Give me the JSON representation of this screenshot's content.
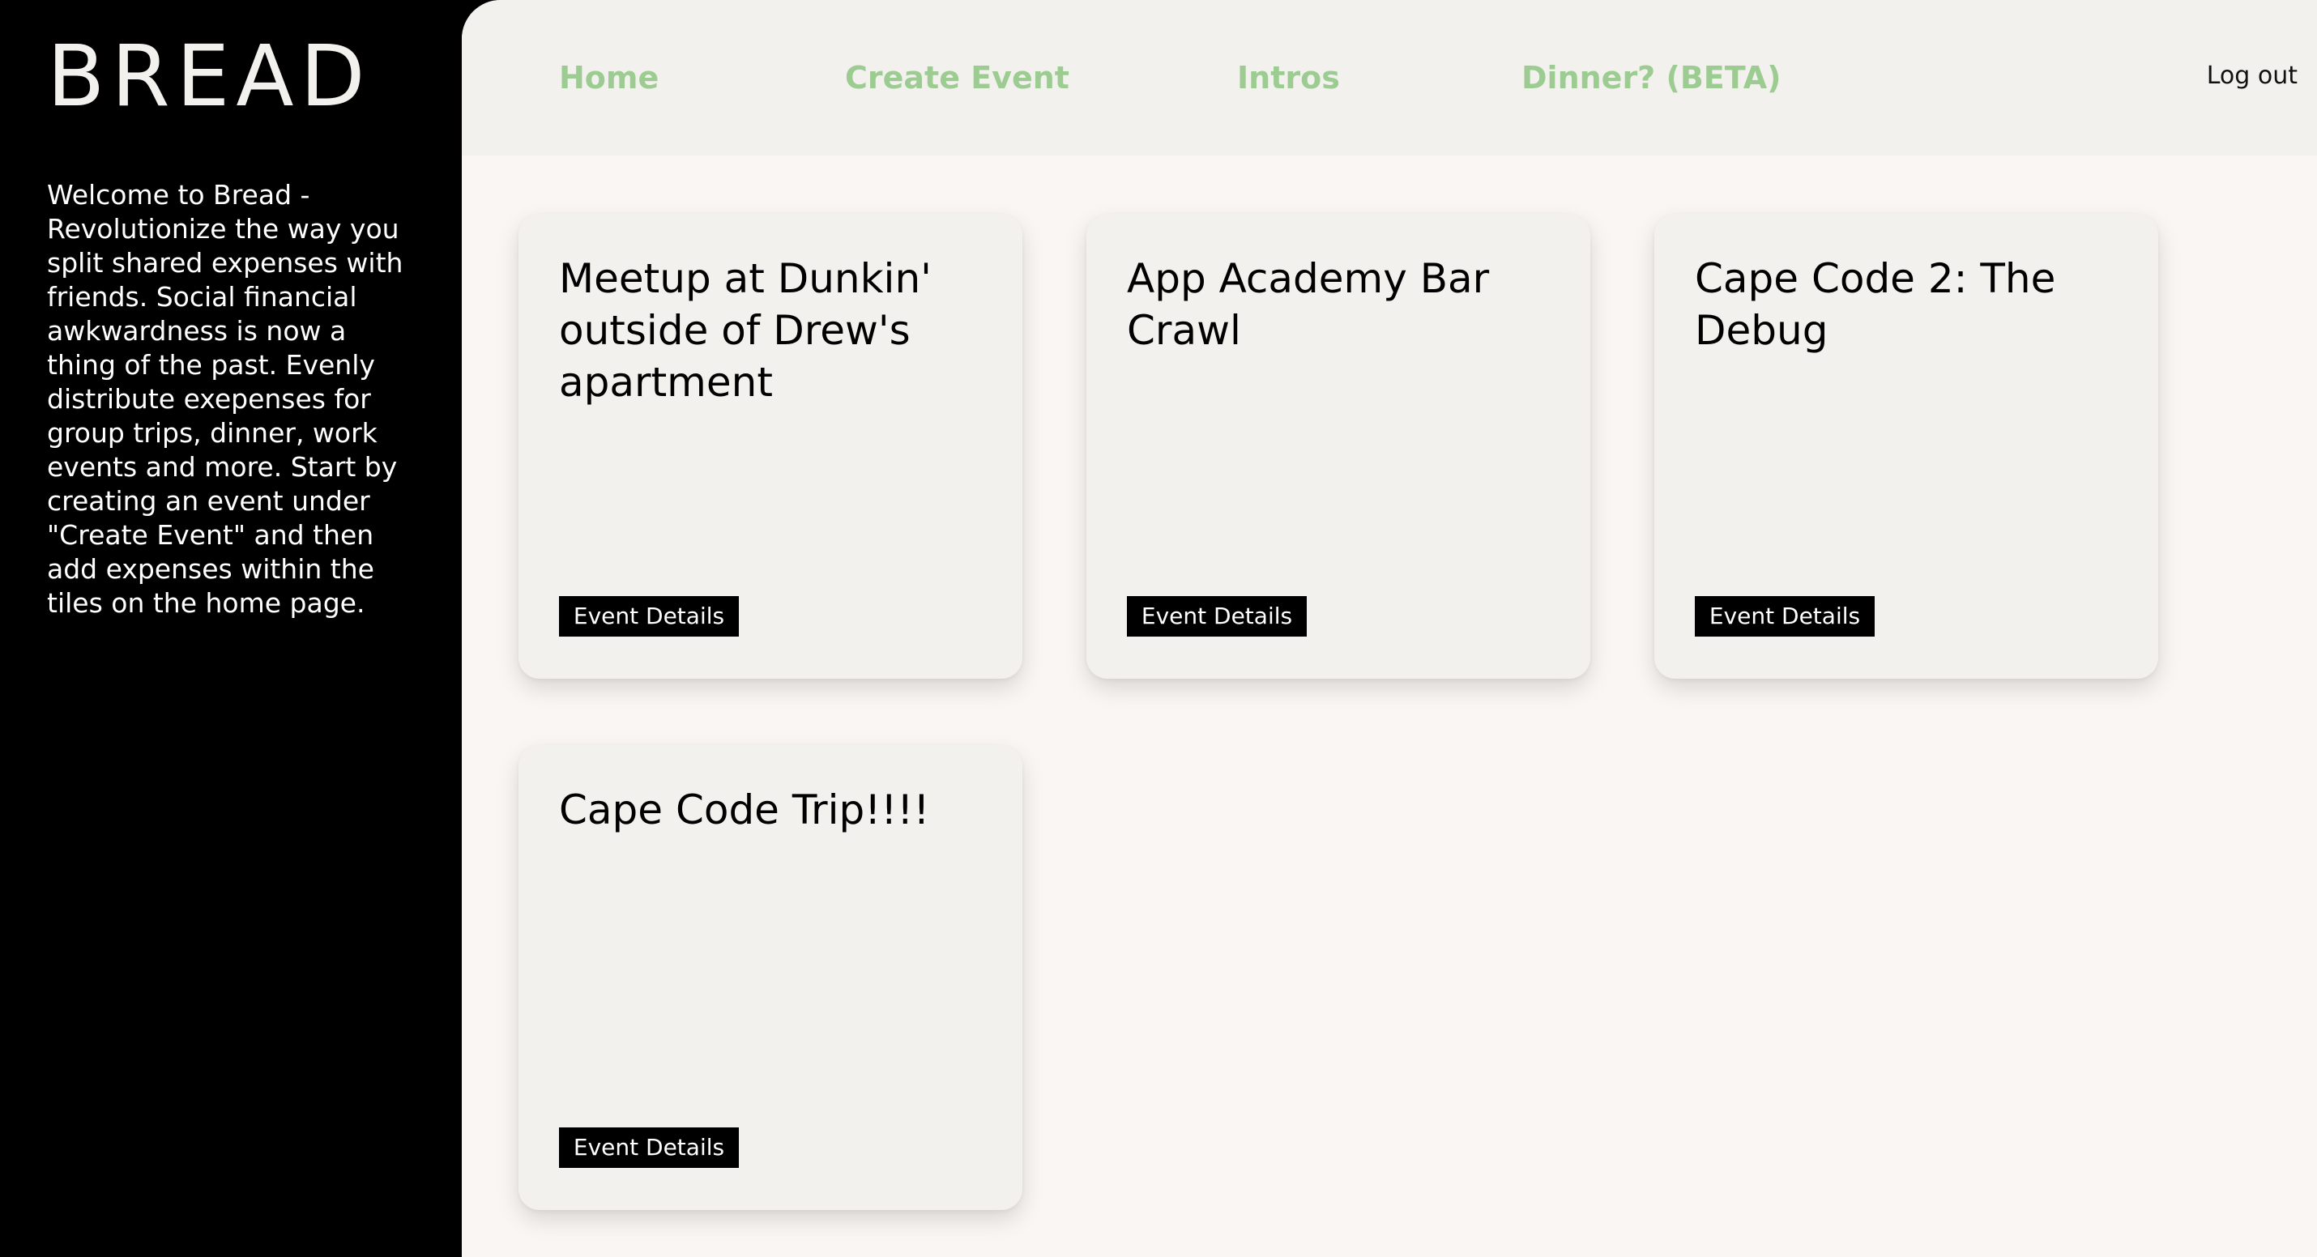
{
  "brand": {
    "logo": "BREAD",
    "welcome": "Welcome to Bread - Revolutionize the way you split shared expenses with friends. Social financial awkwardness is now a thing of the past. Evenly distribute exepenses for group trips, dinner, work events and more. Start by creating an event under \"Create Event\" and then add expenses within the tiles on the home page."
  },
  "nav": {
    "links": [
      {
        "label": "Home"
      },
      {
        "label": "Create Event"
      },
      {
        "label": "Intros"
      },
      {
        "label": "Dinner? (BETA)"
      }
    ],
    "logout": "Log out"
  },
  "events": [
    {
      "title": "Meetup at Dunkin' outside of Drew's apartment",
      "button": "Event Details"
    },
    {
      "title": "App Academy Bar Crawl",
      "button": "Event Details"
    },
    {
      "title": "Cape Code 2: The Debug",
      "button": "Event Details"
    },
    {
      "title": "Cape Code Trip!!!!",
      "button": "Event Details"
    }
  ],
  "colors": {
    "sidebar_bg": "#000000",
    "nav_link": "#9ccc92",
    "main_bg": "#f9f6f3",
    "card_bg": "#f3f1ed"
  }
}
